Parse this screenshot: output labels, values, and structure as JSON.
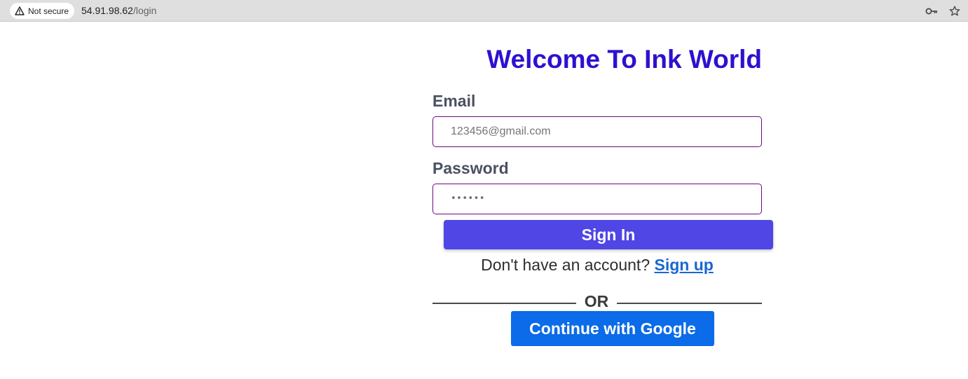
{
  "browser": {
    "security_label": "Not secure",
    "url_host": "54.91.98.62",
    "url_path": "/login",
    "icons": [
      "warning-icon",
      "key-icon",
      "star-icon"
    ]
  },
  "login": {
    "title": "Welcome To Ink World",
    "email_label": "Email",
    "email_placeholder": "123456@gmail.com",
    "password_label": "Password",
    "password_value": "••••••",
    "signin_label": "Sign In",
    "signup_prompt": "Don't have an account? ",
    "signup_link": "Sign up",
    "divider_text": "OR",
    "google_label": "Continue with Google"
  },
  "colors": {
    "title": "#2d11cf",
    "label": "#4a5160",
    "field_border": "#6c0a7d",
    "signin_button": "#4f46e5",
    "signup_link": "#1967d2",
    "google_button": "#0b6be8"
  }
}
